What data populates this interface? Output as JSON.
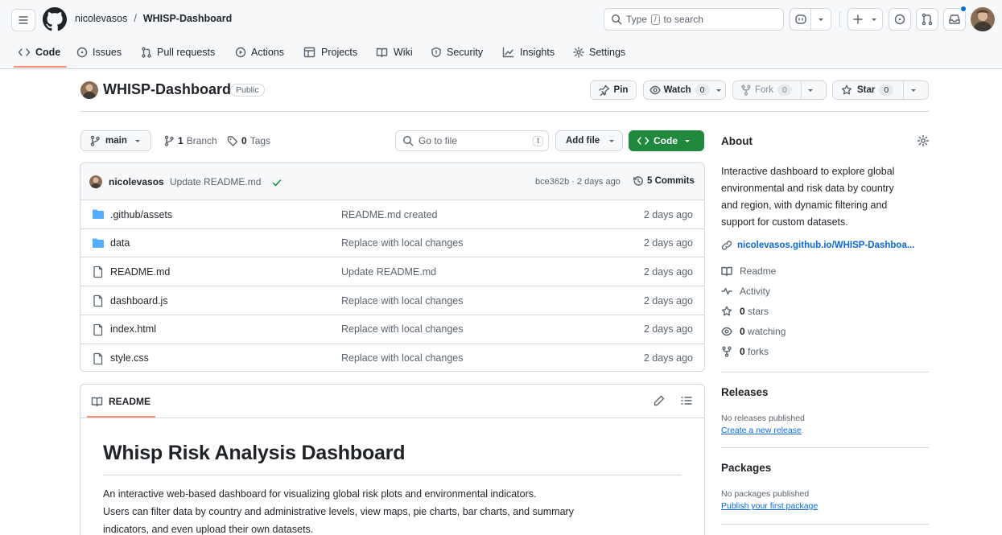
{
  "header": {
    "owner": "nicolevasos",
    "separator": "/",
    "repo": "WHISP-Dashboard",
    "search_prefix": "Type",
    "search_key": "/",
    "search_suffix": "to search"
  },
  "nav": {
    "tabs": [
      {
        "label": "Code",
        "icon": "code-icon"
      },
      {
        "label": "Issues",
        "icon": "issue-icon"
      },
      {
        "label": "Pull requests",
        "icon": "pull-request-icon"
      },
      {
        "label": "Actions",
        "icon": "play-icon"
      },
      {
        "label": "Projects",
        "icon": "table-icon"
      },
      {
        "label": "Wiki",
        "icon": "book-icon"
      },
      {
        "label": "Security",
        "icon": "shield-icon"
      },
      {
        "label": "Insights",
        "icon": "graph-icon"
      },
      {
        "label": "Settings",
        "icon": "gear-icon"
      }
    ]
  },
  "repo_head": {
    "title": "WHISP-Dashboard",
    "visibility": "Public",
    "pin": "Pin",
    "watch": "Watch",
    "watch_count": "0",
    "fork": "Fork",
    "fork_count": "0",
    "star": "Star",
    "star_count": "0"
  },
  "toolbar": {
    "branch": "main",
    "branch_count": "1",
    "branch_label": "Branch",
    "tag_count": "0",
    "tag_label": "Tags",
    "goto_placeholder": "Go to file",
    "goto_key": "t",
    "add_file": "Add file",
    "code": "Code"
  },
  "commit": {
    "author": "nicolevasos",
    "message": "Update README.md",
    "hash_time": "bce362b · 2 days ago",
    "commits": "5 Commits"
  },
  "files": [
    {
      "name": ".github/assets",
      "type": "folder",
      "message": "README.md created",
      "age": "2 days ago"
    },
    {
      "name": "data",
      "type": "folder",
      "message": "Replace with local changes",
      "age": "2 days ago"
    },
    {
      "name": "README.md",
      "type": "file",
      "message": "Update README.md",
      "age": "2 days ago"
    },
    {
      "name": "dashboard.js",
      "type": "file",
      "message": "Replace with local changes",
      "age": "2 days ago"
    },
    {
      "name": "index.html",
      "type": "file",
      "message": "Replace with local changes",
      "age": "2 days ago"
    },
    {
      "name": "style.css",
      "type": "file",
      "message": "Replace with local changes",
      "age": "2 days ago"
    }
  ],
  "readme": {
    "tab": "README",
    "heading": "Whisp Risk Analysis Dashboard",
    "para1": "An interactive web-based dashboard for visualizing global risk plots and environmental indicators.",
    "para2": "Users can filter data by country and administrative levels, view maps, pie charts, bar charts, and summary",
    "para3": "indicators, and even upload their own datasets."
  },
  "about": {
    "title": "About",
    "description_lines": [
      "Interactive dashboard to explore global",
      "environmental and risk data by country",
      "and region, with dynamic filtering and",
      "support for custom datasets."
    ],
    "link": "nicolevasos.github.io/WHISP-Dashboa...",
    "readme": "Readme",
    "activity": "Activity",
    "stars_count": "0",
    "stars_label": "stars",
    "watching_count": "0",
    "watching_label": "watching",
    "forks_count": "0",
    "forks_label": "forks"
  },
  "releases": {
    "title": "Releases",
    "empty": "No releases published",
    "action": "Create a new release"
  },
  "packages": {
    "title": "Packages",
    "empty": "No packages published",
    "action": "Publish your first package"
  },
  "colors": {
    "accent": "#0969da",
    "code_button": "#1f883d",
    "active_tab": "#fd8c73",
    "folder": "#54aeff",
    "notification": "#0969da"
  }
}
